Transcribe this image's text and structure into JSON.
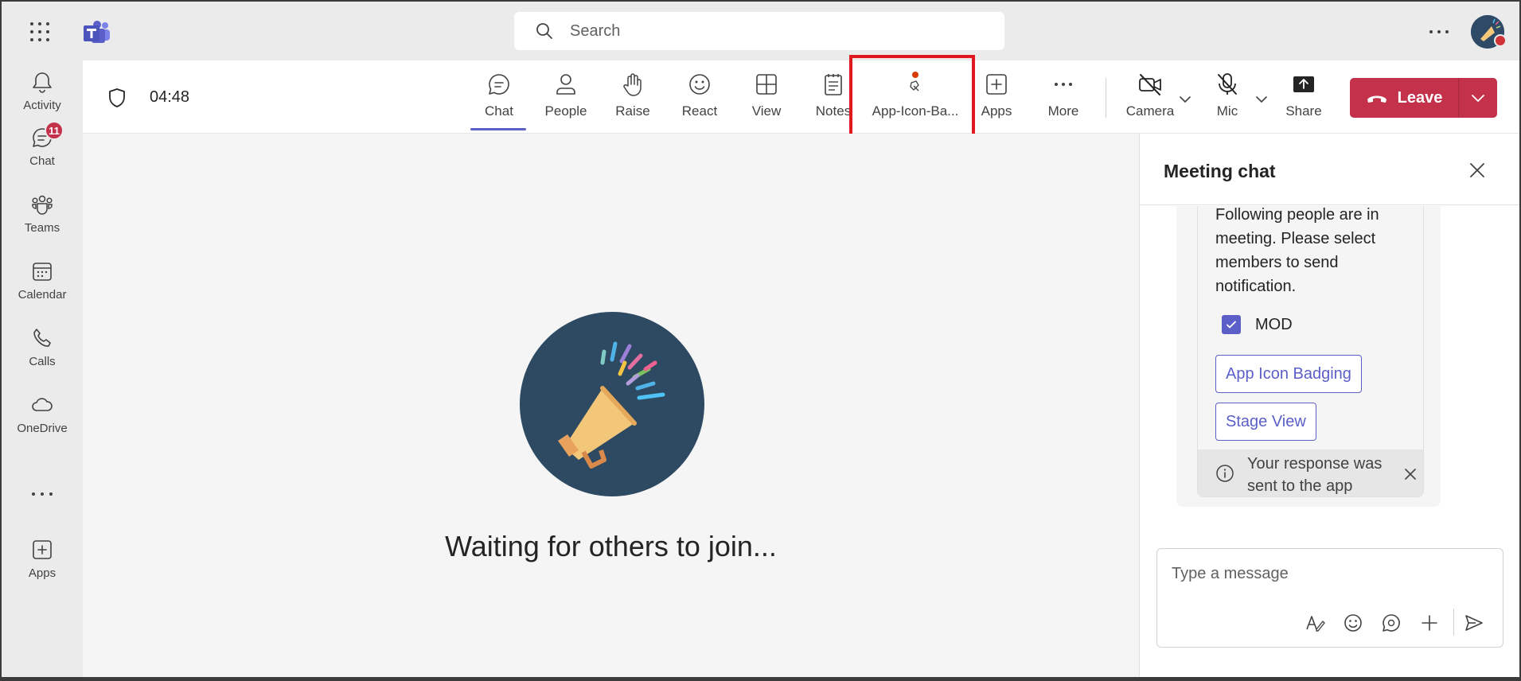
{
  "search": {
    "placeholder": "Search"
  },
  "rail": {
    "items": [
      {
        "label": "Activity",
        "icon": "bell-icon"
      },
      {
        "label": "Chat",
        "icon": "chat-icon",
        "badge": "11"
      },
      {
        "label": "Teams",
        "icon": "teams-icon"
      },
      {
        "label": "Calendar",
        "icon": "calendar-icon"
      },
      {
        "label": "Calls",
        "icon": "phone-icon"
      },
      {
        "label": "OneDrive",
        "icon": "cloud-icon"
      },
      {
        "label": "Apps",
        "icon": "add-app-icon"
      }
    ]
  },
  "meeting": {
    "timer": "04:48",
    "toolbar": {
      "chat": "Chat",
      "people": "People",
      "raise": "Raise",
      "react": "React",
      "view": "View",
      "notes": "Notes",
      "app_icon_badging": "App-Icon-Ba...",
      "apps": "Apps",
      "more": "More",
      "camera": "Camera",
      "mic": "Mic",
      "share": "Share",
      "leave": "Leave"
    },
    "stage": {
      "waiting_text": "Waiting for others to join..."
    }
  },
  "chat_panel": {
    "title": "Meeting chat",
    "card": {
      "text": "Following people are in meeting. Please select members to send notification.",
      "checkbox_label": "MOD",
      "checkbox_checked": true,
      "buttons": [
        "App Icon Badging",
        "Stage View"
      ],
      "toast": "Your response was sent to the app"
    },
    "compose_placeholder": "Type a message"
  },
  "colors": {
    "accent": "#5b5fc7",
    "leave": "#c4314b",
    "highlight_box": "#e0191f",
    "badge": "#c4314b"
  }
}
